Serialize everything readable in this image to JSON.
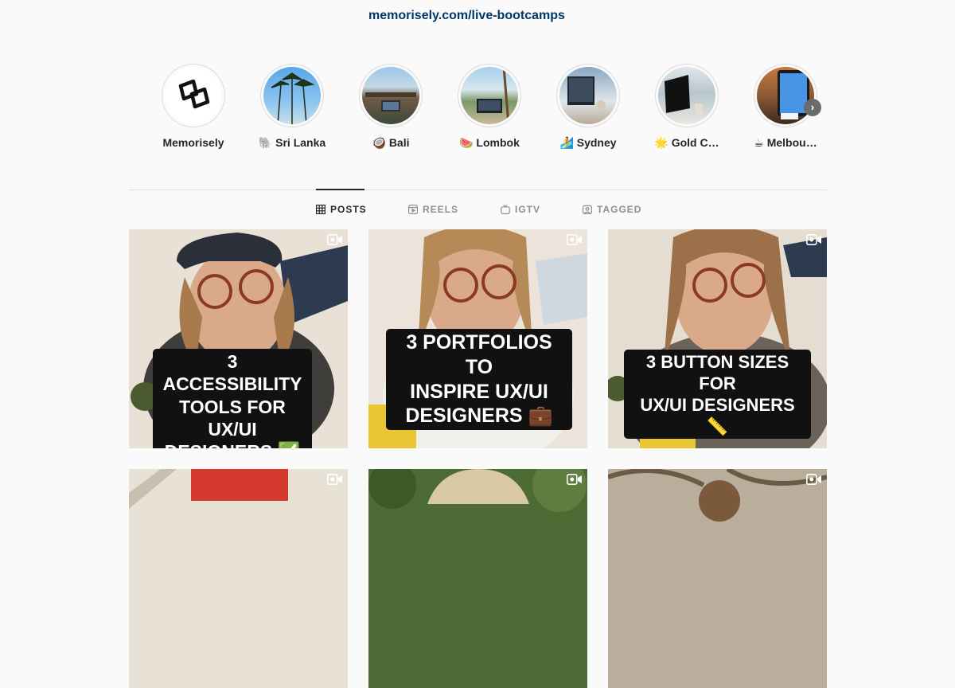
{
  "profile": {
    "link": "memorisely.com/live-bootcamps"
  },
  "highlights": [
    {
      "label": "Memorisely",
      "icon": "memorisely-logo-icon"
    },
    {
      "label": "🐘 Sri Lanka",
      "icon": "palm-trees-photo"
    },
    {
      "label": "🥥 Bali",
      "icon": "bali-photo"
    },
    {
      "label": "🍉 Lombok",
      "icon": "lombok-photo"
    },
    {
      "label": "🏄 Sydney",
      "icon": "sydney-photo"
    },
    {
      "label": "🌟 Gold C…",
      "icon": "gold-coast-photo"
    },
    {
      "label": "☕ Melbou…",
      "icon": "melbourne-photo"
    }
  ],
  "tabs": [
    {
      "label": "POSTS",
      "icon": "grid-icon",
      "active": true
    },
    {
      "label": "REELS",
      "icon": "reels-icon",
      "active": false
    },
    {
      "label": "IGTV",
      "icon": "igtv-icon",
      "active": false
    },
    {
      "label": "TAGGED",
      "icon": "tagged-icon",
      "active": false
    }
  ],
  "posts": [
    {
      "caption_lines": [
        "3 ACCESSIBILITY",
        "TOOLS FOR UX/UI",
        "DESIGNERS ✅"
      ],
      "type": "reel"
    },
    {
      "caption_lines": [
        "3 PORTFOLIOS TO",
        "INSPIRE UX/UI",
        "DESIGNERS 💼"
      ],
      "type": "reel"
    },
    {
      "caption_lines": [
        "3 BUTTON SIZES FOR",
        "UX/UI DESIGNERS 📏"
      ],
      "type": "reel"
    },
    {
      "caption_lines": [],
      "type": "reel"
    },
    {
      "caption_lines": [],
      "type": "reel"
    },
    {
      "caption_lines": [],
      "type": "reel"
    }
  ],
  "colors": {
    "background": "#fafafa",
    "link": "#00376b",
    "text": "#262626",
    "muted": "#8e8e8e"
  }
}
